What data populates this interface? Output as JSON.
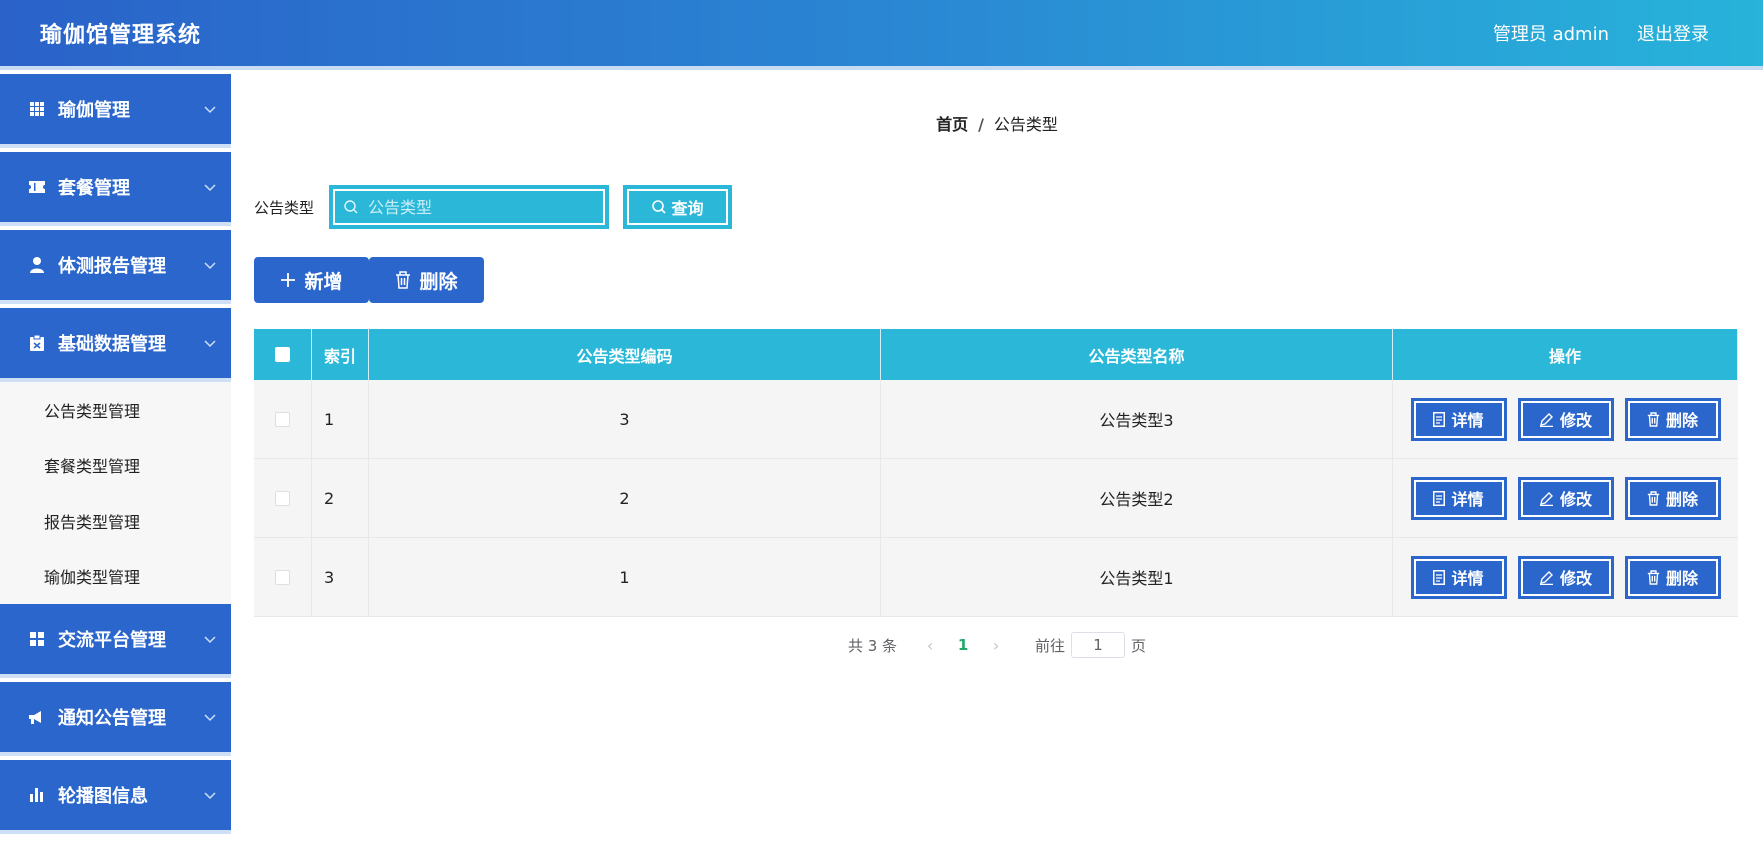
{
  "header": {
    "title": "瑜伽馆管理系统",
    "user_label": "管理员 admin",
    "logout_label": "退出登录"
  },
  "sidebar": {
    "groups": [
      {
        "label": "瑜伽管理",
        "icon": "grid-icon"
      },
      {
        "label": "套餐管理",
        "icon": "ticket-icon"
      },
      {
        "label": "体测报告管理",
        "icon": "user-icon"
      },
      {
        "label": "基础数据管理",
        "icon": "clipboard-icon"
      },
      {
        "label": "交流平台管理",
        "icon": "apps-icon"
      },
      {
        "label": "通知公告管理",
        "icon": "megaphone-icon"
      },
      {
        "label": "轮播图信息",
        "icon": "bar-chart-icon"
      }
    ],
    "sub_items": [
      "公告类型管理",
      "套餐类型管理",
      "报告类型管理",
      "瑜伽类型管理"
    ]
  },
  "breadcrumb": {
    "home": "首页",
    "separator": "/",
    "current": "公告类型"
  },
  "search": {
    "label": "公告类型",
    "placeholder": "公告类型",
    "query_label": "查询"
  },
  "actions": {
    "add_label": "新增",
    "delete_label": "删除"
  },
  "table": {
    "headers": [
      "索引",
      "公告类型编码",
      "公告类型名称",
      "操作"
    ],
    "rows": [
      {
        "index": "1",
        "code": "3",
        "name": "公告类型3"
      },
      {
        "index": "2",
        "code": "2",
        "name": "公告类型2"
      },
      {
        "index": "3",
        "code": "1",
        "name": "公告类型1"
      }
    ],
    "row_actions": {
      "detail": "详情",
      "edit": "修改",
      "delete": "删除"
    }
  },
  "pagination": {
    "total_text": "共 3 条",
    "current_page": "1",
    "goto_label": "前往",
    "jump_value": "1",
    "page_suffix": "页"
  },
  "colors": {
    "primary": "#2a66cc",
    "accent": "#2bb8d8",
    "page_active": "#22a86a"
  }
}
